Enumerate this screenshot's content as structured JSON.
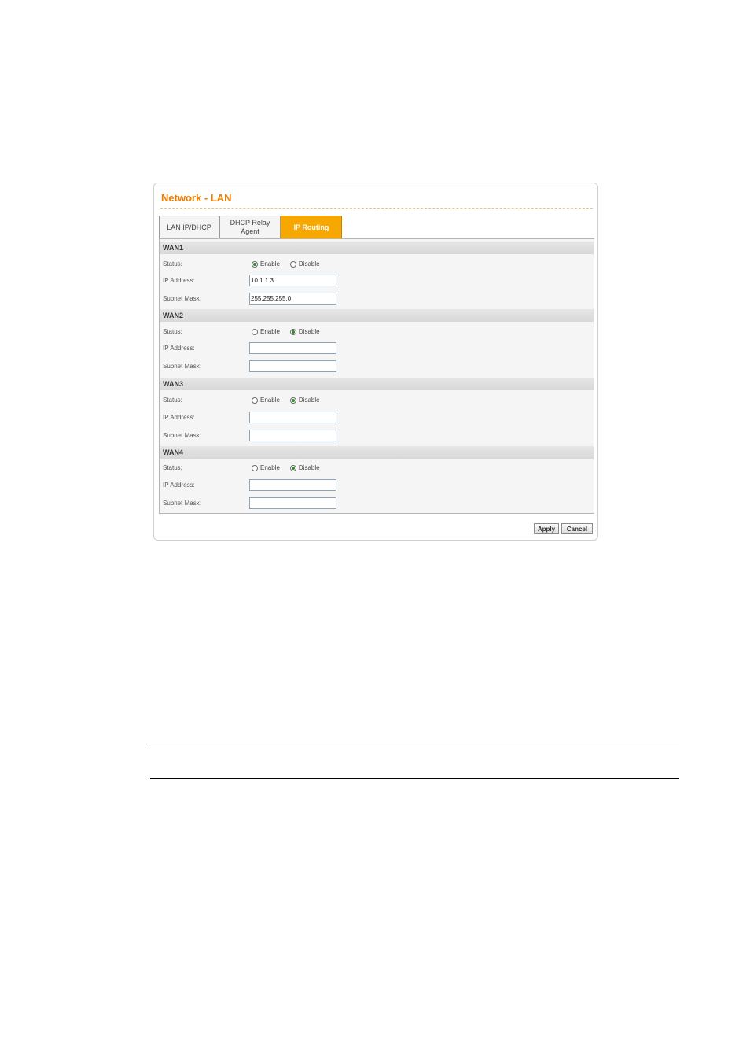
{
  "panel": {
    "title": "Network - LAN"
  },
  "tabs": [
    {
      "label": "LAN IP/DHCP",
      "active": false
    },
    {
      "label": "DHCP Relay Agent",
      "active": true
    },
    {
      "label": "IP Routing",
      "active": true
    }
  ],
  "labels": {
    "status": "Status:",
    "ip_address": "IP Address:",
    "subnet_mask": "Subnet Mask:",
    "enable": "Enable",
    "disable": "Disable"
  },
  "wans": [
    {
      "name": "WAN1",
      "status": "Enable",
      "ip_address": "10.1.1.3",
      "subnet_mask": "255.255.255.0"
    },
    {
      "name": "WAN2",
      "status": "Disable",
      "ip_address": "",
      "subnet_mask": ""
    },
    {
      "name": "WAN3",
      "status": "Disable",
      "ip_address": "",
      "subnet_mask": ""
    },
    {
      "name": "WAN4",
      "status": "Disable",
      "ip_address": "",
      "subnet_mask": ""
    }
  ],
  "buttons": {
    "apply": "Apply",
    "cancel": "Cancel"
  },
  "colors": {
    "accent": "#f07d00",
    "active_tab": "#f7a800",
    "radio_selected": "#2d8a2d"
  }
}
